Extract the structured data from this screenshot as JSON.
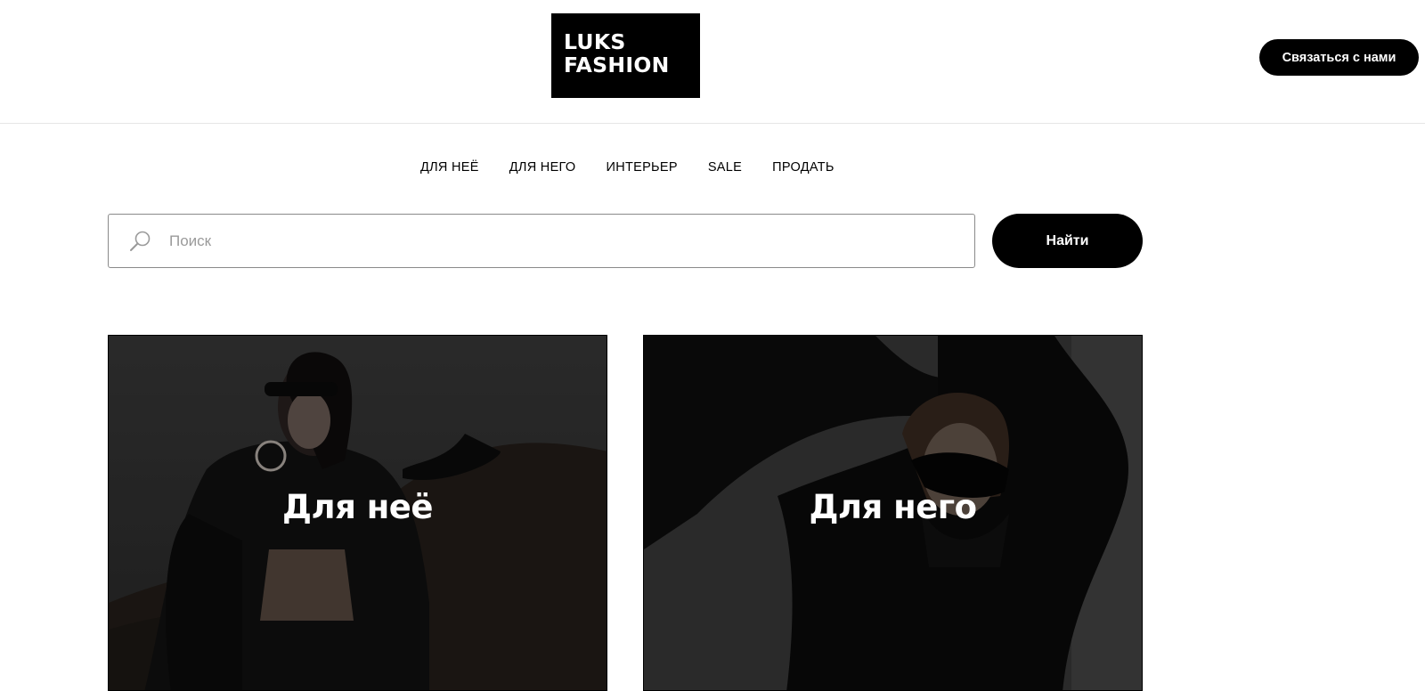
{
  "header": {
    "logo_line1": "LUKS",
    "logo_line2": "FASHION",
    "contact_label": "Связаться с нами"
  },
  "nav": {
    "items": [
      {
        "label": "ДЛЯ НЕЁ"
      },
      {
        "label": "ДЛЯ НЕГО"
      },
      {
        "label": "ИНТЕРЬЕР"
      },
      {
        "label": "SALE"
      },
      {
        "label": "ПРОДАТЬ"
      }
    ]
  },
  "search": {
    "placeholder": "Поиск",
    "value": "",
    "button_label": "Найти",
    "icon": "search-icon"
  },
  "categories": [
    {
      "title": "Для неё",
      "image": "woman-in-sunglasses-photo"
    },
    {
      "title": "Для него",
      "image": "man-in-sunglasses-photo"
    }
  ],
  "colors": {
    "primary": "#000000",
    "background": "#ffffff",
    "on_primary": "#ffffff"
  }
}
